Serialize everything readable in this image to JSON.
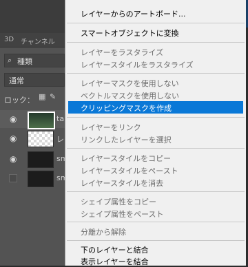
{
  "panel": {
    "tabs": [
      "3D",
      "チャンネル"
    ],
    "search_icon": "search-icon",
    "filter_label": "種類",
    "blend_mode": "通常",
    "lock_label": "ロック：",
    "layers": [
      {
        "name": "ta",
        "visible": true
      },
      {
        "name": "レ",
        "visible": true
      },
      {
        "name": "sm",
        "visible": true
      },
      {
        "name": "sm",
        "visible": false
      }
    ]
  },
  "menu": {
    "items": [
      {
        "label": "レイヤーからのアートボード...",
        "state": "enabled"
      },
      {
        "label": "スマートオブジェクトに変換",
        "state": "enabled"
      },
      {
        "label": "レイヤーをラスタライズ",
        "state": "disabled"
      },
      {
        "label": "レイヤースタイルをラスタライズ",
        "state": "disabled"
      },
      {
        "label": "レイヤーマスクを使用しない",
        "state": "disabled"
      },
      {
        "label": "ベクトルマスクを使用しない",
        "state": "disabled"
      },
      {
        "label": "クリッピングマスクを作成",
        "state": "highlighted"
      },
      {
        "label": "レイヤーをリンク",
        "state": "disabled"
      },
      {
        "label": "リンクしたレイヤーを選択",
        "state": "disabled"
      },
      {
        "label": "レイヤースタイルをコピー",
        "state": "disabled"
      },
      {
        "label": "レイヤースタイルをペースト",
        "state": "disabled"
      },
      {
        "label": "レイヤースタイルを消去",
        "state": "disabled"
      },
      {
        "label": "シェイプ属性をコピー",
        "state": "disabled"
      },
      {
        "label": "シェイプ属性をペースト",
        "state": "disabled"
      },
      {
        "label": "分離から解除",
        "state": "disabled"
      },
      {
        "label": "下のレイヤーと結合",
        "state": "enabled"
      },
      {
        "label": "表示レイヤーを結合",
        "state": "enabled"
      }
    ]
  },
  "colors": {
    "highlight": "#0a78d7",
    "menu_bg": "#f0f0f0",
    "panel_bg": "#535353"
  }
}
